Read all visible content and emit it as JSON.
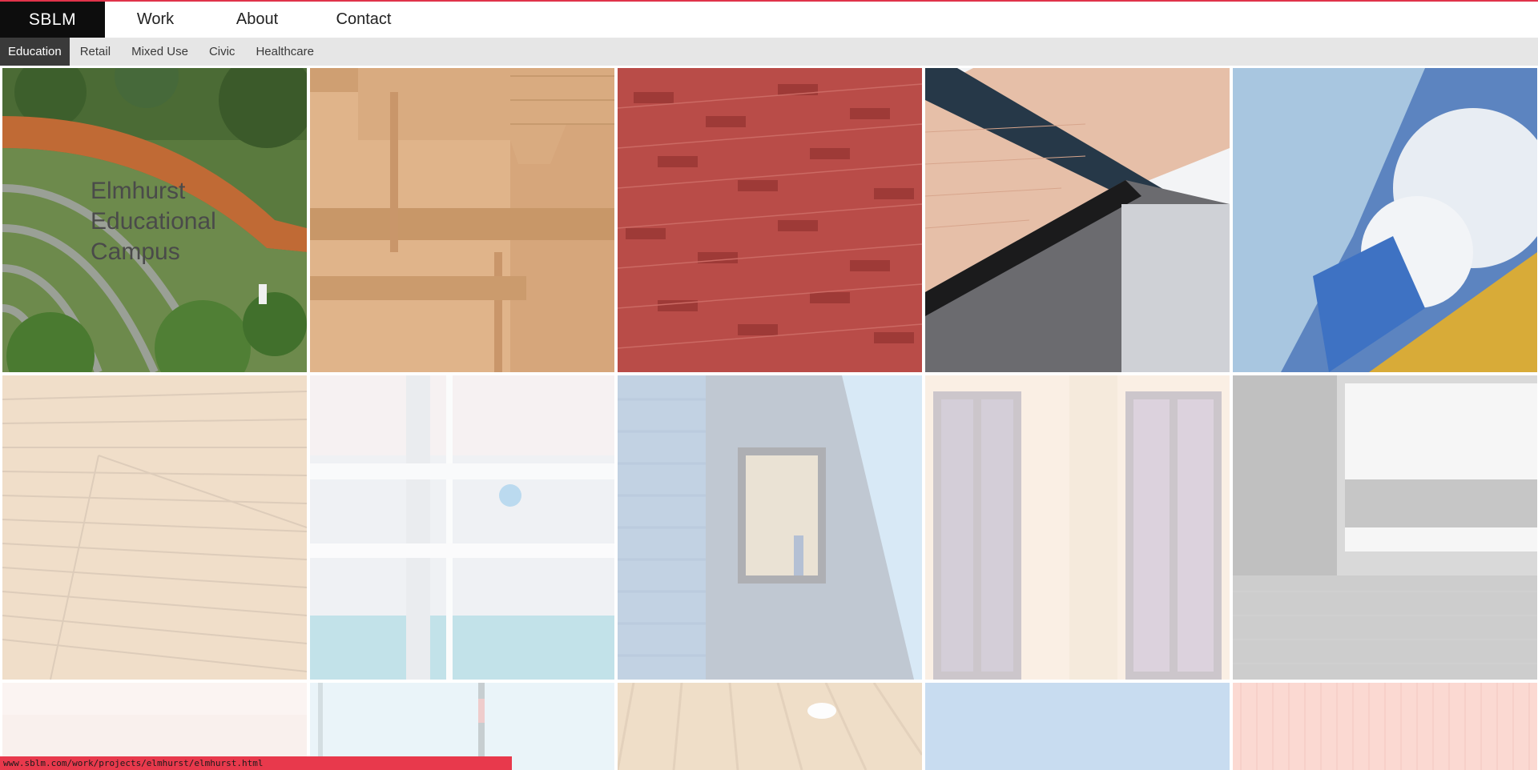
{
  "header": {
    "brand": "SBLM",
    "nav": [
      {
        "label": "Work"
      },
      {
        "label": "About"
      },
      {
        "label": "Contact"
      }
    ]
  },
  "subnav": {
    "items": [
      {
        "label": "Education",
        "active": true
      },
      {
        "label": "Retail"
      },
      {
        "label": "Mixed Use"
      },
      {
        "label": "Civic"
      },
      {
        "label": "Healthcare"
      }
    ]
  },
  "grid": {
    "featured_caption": "Elmhurst\nEducational\nCampus"
  },
  "statusbar": {
    "url": "www.sblm.com/work/projects/elmhurst/elmhurst.html"
  },
  "colors": {
    "accent": "#e0334a",
    "brand_bg": "#0d0d0d",
    "subnav_bg": "#e6e6e6",
    "subnav_active_bg": "#3a3a3a"
  }
}
